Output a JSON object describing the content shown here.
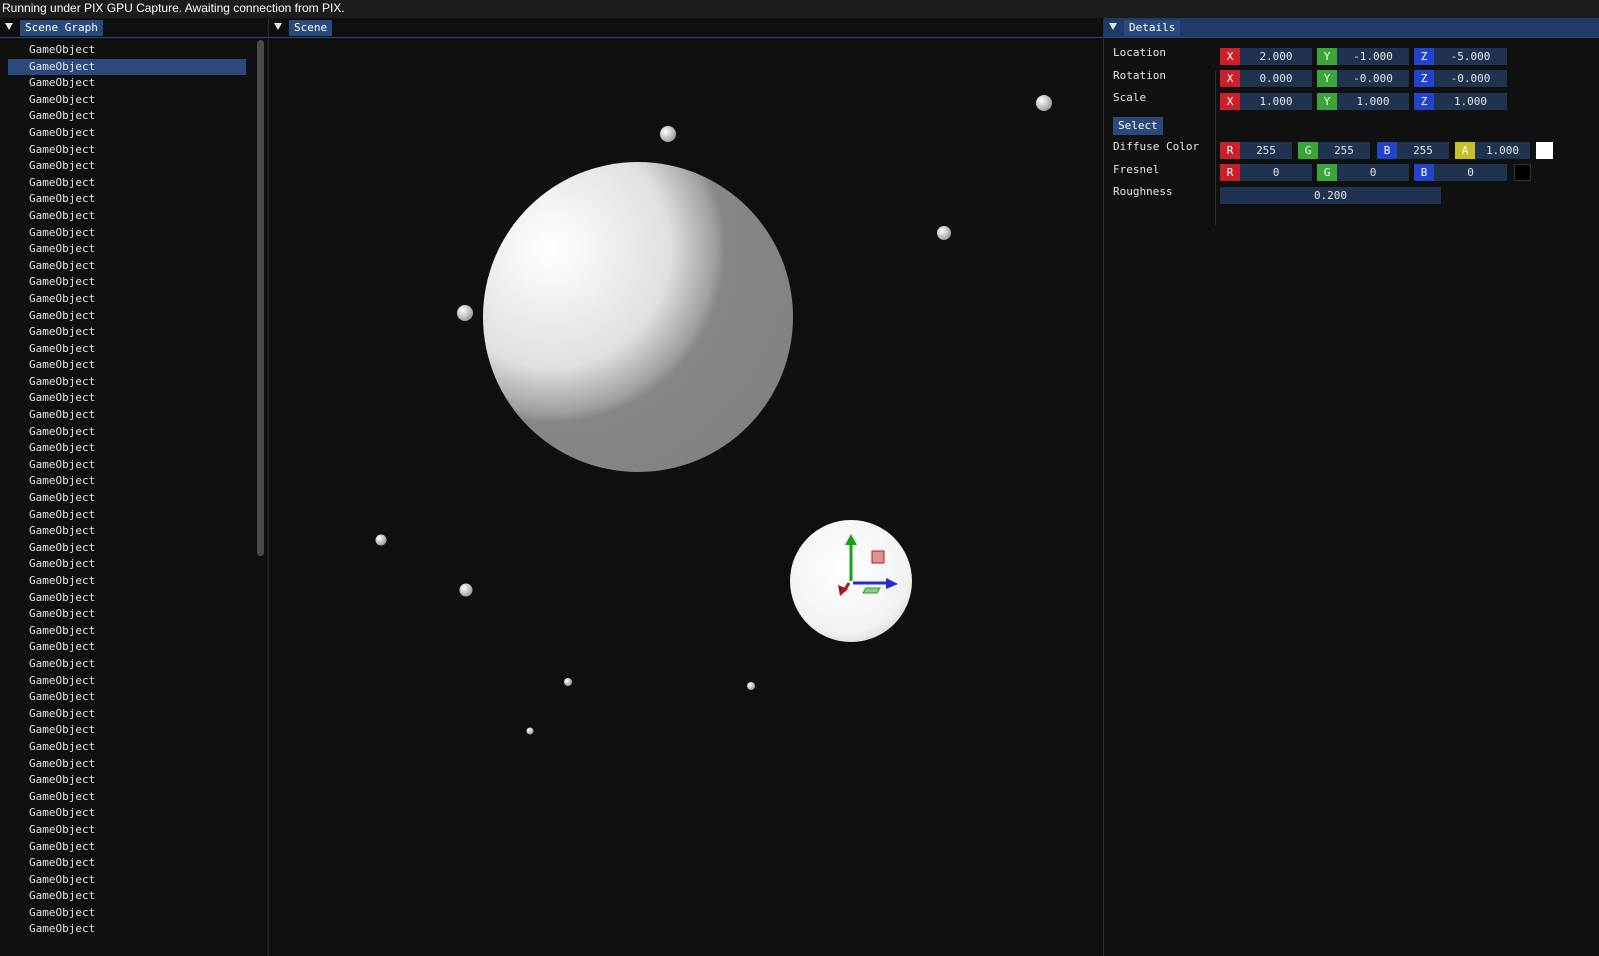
{
  "status_bar": {
    "text": "Running under PIX GPU Capture. Awaiting connection from PIX."
  },
  "scene_graph": {
    "title": "Scene Graph",
    "selected_index": 1,
    "items": [
      "GameObject",
      "GameObject",
      "GameObject",
      "GameObject",
      "GameObject",
      "GameObject",
      "GameObject",
      "GameObject",
      "GameObject",
      "GameObject",
      "GameObject",
      "GameObject",
      "GameObject",
      "GameObject",
      "GameObject",
      "GameObject",
      "GameObject",
      "GameObject",
      "GameObject",
      "GameObject",
      "GameObject",
      "GameObject",
      "GameObject",
      "GameObject",
      "GameObject",
      "GameObject",
      "GameObject",
      "GameObject",
      "GameObject",
      "GameObject",
      "GameObject",
      "GameObject",
      "GameObject",
      "GameObject",
      "GameObject",
      "GameObject",
      "GameObject",
      "GameObject",
      "GameObject",
      "GameObject",
      "GameObject",
      "GameObject",
      "GameObject",
      "GameObject",
      "GameObject",
      "GameObject",
      "GameObject",
      "GameObject",
      "GameObject",
      "GameObject",
      "GameObject",
      "GameObject",
      "GameObject",
      "GameObject"
    ]
  },
  "scene": {
    "title": "Scene"
  },
  "details": {
    "title": "Details",
    "location": {
      "label": "Location",
      "x_tag": "X",
      "x": "2.000",
      "y_tag": "Y",
      "y": "-1.000",
      "z_tag": "Z",
      "z": "-5.000"
    },
    "rotation": {
      "label": "Rotation",
      "x_tag": "X",
      "x": "0.000",
      "y_tag": "Y",
      "y": "-0.000",
      "z_tag": "Z",
      "z": "-0.000"
    },
    "scale": {
      "label": "Scale",
      "x_tag": "X",
      "x": "1.000",
      "y_tag": "Y",
      "y": "1.000",
      "z_tag": "Z",
      "z": "1.000"
    },
    "select_button": "Select",
    "diffuse": {
      "label": "Diffuse Color",
      "r_tag": "R",
      "r": "255",
      "g_tag": "G",
      "g": "255",
      "b_tag": "B",
      "b": "255",
      "a_tag": "A",
      "a": "1.000",
      "swatch_color": "#ffffff"
    },
    "fresnel": {
      "label": "Fresnel",
      "r_tag": "R",
      "r": "0",
      "g_tag": "G",
      "g": "0",
      "b_tag": "B",
      "b": "0",
      "swatch_color": "#000000"
    },
    "roughness": {
      "label": "Roughness",
      "value": "0.200"
    }
  },
  "colors": {
    "accent": "#294a7a",
    "x_axis": "#cc1f2a",
    "y_axis": "#3aa63a",
    "z_axis": "#2244cc",
    "alpha": "#c8c02a"
  }
}
